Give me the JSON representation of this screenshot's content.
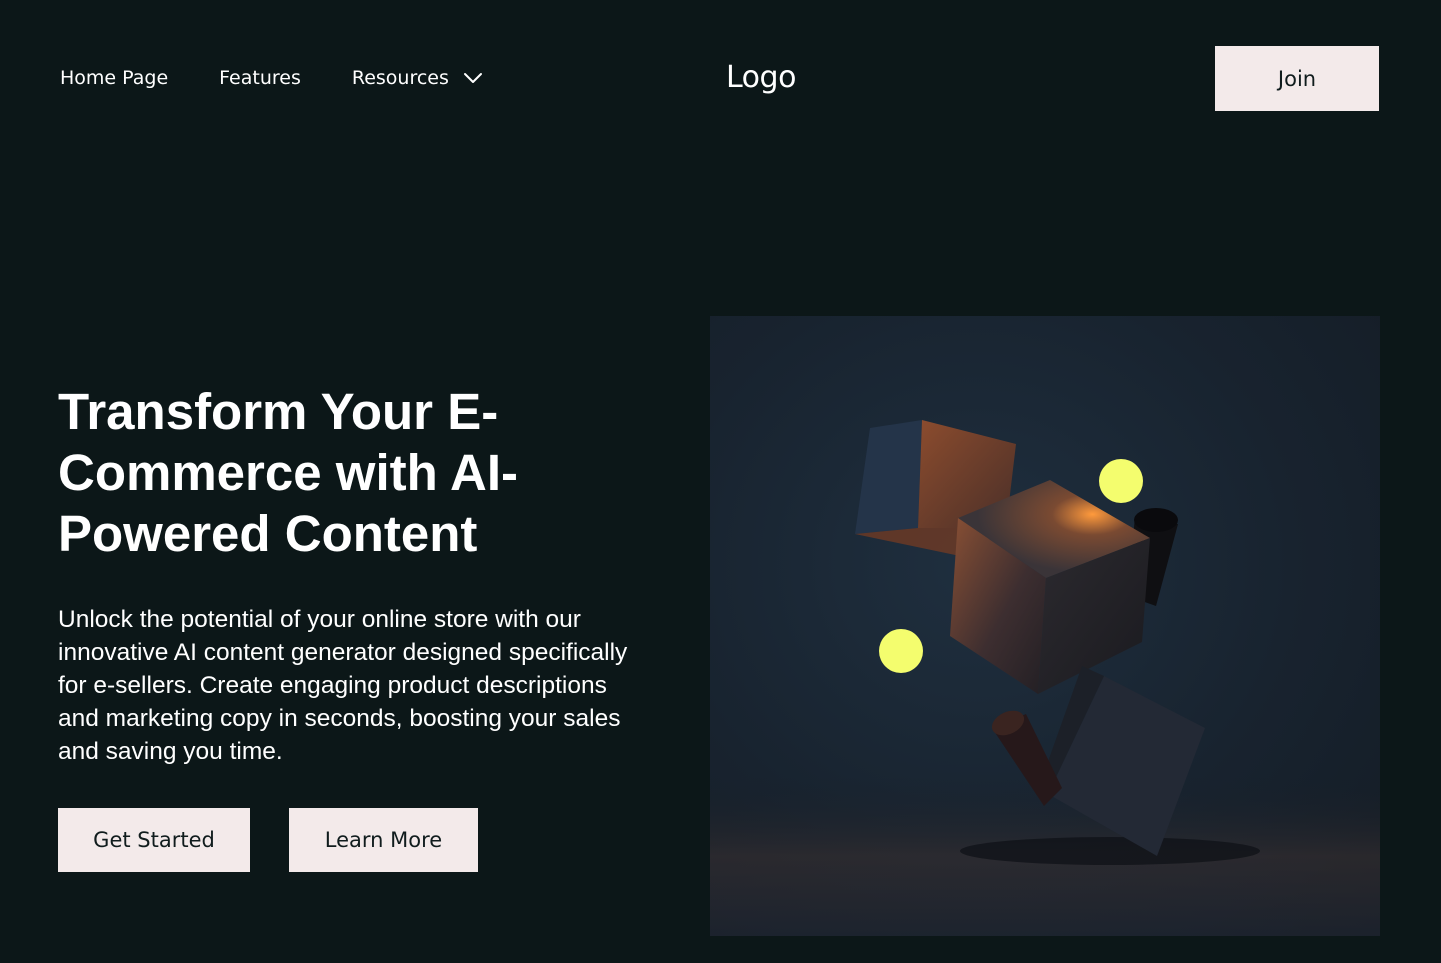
{
  "header": {
    "nav": {
      "home": "Home Page",
      "features": "Features",
      "resources": "Resources"
    },
    "logo": "Logo",
    "join_label": "Join"
  },
  "hero": {
    "title": "Transform Your E-Commerce with AI-Powered Content",
    "subtitle": "Unlock the potential of your online store with our innovative AI content generator designed specifically for e-sellers. Create engaging product descriptions and marketing copy in seconds, boosting your sales and saving you time.",
    "primary_label": "Get Started",
    "secondary_label": "Learn More"
  },
  "colors": {
    "background": "#0c1718",
    "button_bg": "#f3eaea",
    "button_text": "#101c1d",
    "accent_sphere": "#f4fd6e"
  },
  "icons": {
    "resources_dropdown": "chevron-down-icon"
  }
}
